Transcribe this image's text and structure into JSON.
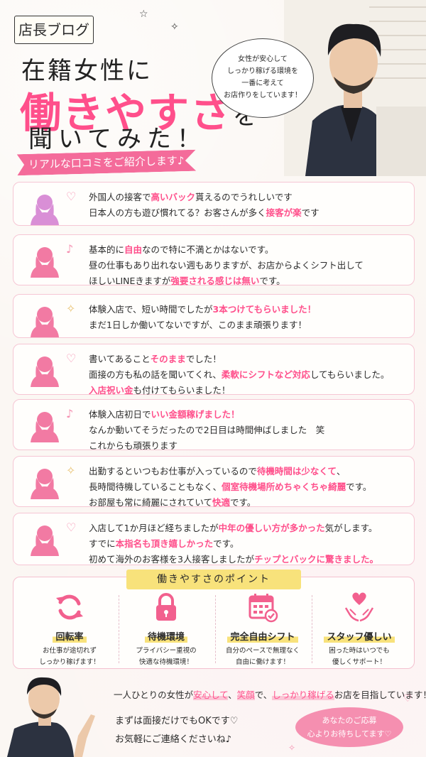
{
  "header": {
    "blog_tag": "店長ブログ",
    "title_line1": "在籍女性に",
    "title_line2_pink": "働きやすさ",
    "title_line2_rest": "を",
    "title_line3": "聞いてみた！",
    "ribbon": "リアルな口コミをご紹介します♪",
    "bubble": [
      "女性が安心して",
      "しっかり稼げる環境を",
      "一番に考えて",
      "お店作りをしています！"
    ]
  },
  "reviews": [
    {
      "avatar_color": "#d98fd6",
      "lines": [
        [
          [
            "外国人の接客で",
            false
          ],
          [
            "高いバック",
            true
          ],
          [
            "貰えるのでうれしいです",
            false
          ]
        ],
        [
          [
            "日本人の方も遊び慣れてる？お客さんが多く",
            false
          ],
          [
            "接客が楽",
            true
          ],
          [
            "です",
            false
          ]
        ]
      ]
    },
    {
      "avatar_color": "#f27aa3",
      "lines": [
        [
          [
            "基本的に",
            false
          ],
          [
            "自由",
            true
          ],
          [
            "なので特に不満とかはないです。",
            false
          ]
        ],
        [
          [
            "昼の仕事もあり出れない週もありますが、お店からよくシフト出して",
            false
          ]
        ],
        [
          [
            "ほしいLINEきますが",
            false
          ],
          [
            "強要される感じは無い",
            true
          ],
          [
            "です。",
            false
          ]
        ]
      ]
    },
    {
      "avatar_color": "#f27aa3",
      "lines": [
        [
          [
            "体験入店で、短い時間でしたが",
            false
          ],
          [
            "3本つけてもらいました！",
            true
          ]
        ],
        [
          [
            "まだ1日しか働いてないですが、このまま頑張ります！",
            false
          ]
        ]
      ]
    },
    {
      "avatar_color": "#f27aa3",
      "lines": [
        [
          [
            "書いてあること",
            false
          ],
          [
            "そのまま",
            true
          ],
          [
            "でした！",
            false
          ]
        ],
        [
          [
            "面接の方も私の話を聞いてくれ、",
            false
          ],
          [
            "柔軟にシフトなど対応",
            true
          ],
          [
            "してもらいました。",
            false
          ]
        ],
        [
          [
            "入店祝い金",
            true
          ],
          [
            "も付けてもらいました！",
            false
          ]
        ]
      ]
    },
    {
      "avatar_color": "#f27aa3",
      "lines": [
        [
          [
            "体験入店初日で",
            false
          ],
          [
            "いい金額稼げました！",
            true
          ]
        ],
        [
          [
            "なんか動いてそうだったので2日目は時間伸ばしました　笑",
            false
          ]
        ],
        [
          [
            "これからも頑張ります",
            false
          ]
        ]
      ]
    },
    {
      "avatar_color": "#f27aa3",
      "lines": [
        [
          [
            "出勤するといつもお仕事が入っているので",
            false
          ],
          [
            "待機時間は少なくて",
            true
          ],
          [
            "、",
            false
          ]
        ],
        [
          [
            "長時間待機していることもなく、",
            false
          ],
          [
            "個室待機場所めちゃくちゃ綺麗",
            true
          ],
          [
            "です。",
            false
          ]
        ],
        [
          [
            "お部屋も常に綺麗にされていて",
            false
          ],
          [
            "快適",
            true
          ],
          [
            "です。",
            false
          ]
        ]
      ]
    },
    {
      "avatar_color": "#f27aa3",
      "lines": [
        [
          [
            "入店して1か月ほど経ちましたが",
            false
          ],
          [
            "中年の優しい方が多かった",
            true
          ],
          [
            "気がします。",
            false
          ]
        ],
        [
          [
            "すでに",
            false
          ],
          [
            "本指名も頂き嬉しかった",
            true
          ],
          [
            "です。",
            false
          ]
        ],
        [
          [
            "初めて海外のお客様を3人接客しましたが",
            false
          ],
          [
            "チップとバックに驚きました。",
            true
          ]
        ]
      ]
    }
  ],
  "points": {
    "label": "働きやすさのポイント",
    "items": [
      {
        "title": "回転率",
        "desc": [
          "お仕事が途切れず",
          "しっかり稼げます！"
        ],
        "icon": "refresh-icon"
      },
      {
        "title": "待機環境",
        "desc": [
          "プライバシー重視の",
          "快適な待機環境！"
        ],
        "icon": "lock-icon"
      },
      {
        "title": "完全自由シフト",
        "desc": [
          "自分のペースで無理なく",
          "自由に働けます！"
        ],
        "icon": "calendar-icon"
      },
      {
        "title": "スタッフ優しい",
        "desc": [
          "困った時はいつでも",
          "優しくサポート！"
        ],
        "icon": "hands-heart-icon"
      }
    ]
  },
  "footer": {
    "line1_parts": [
      [
        "一人ひとりの女性が",
        false
      ],
      [
        "安心して",
        true
      ],
      [
        "、",
        false
      ],
      [
        "笑顔",
        true
      ],
      [
        "で、",
        false
      ],
      [
        "しっかり稼げる",
        true
      ],
      [
        "お店を目指しています！",
        false
      ]
    ],
    "line2": "まずは面接だけでもOKです♡",
    "line3": "お気軽にご連絡くださいね♪",
    "cta_line1": "あなたのご応募",
    "cta_line2": "心よりお待ちしてます♡"
  },
  "colors": {
    "accent": "#ff4f8b",
    "ribbon": "#f46b9a",
    "highlight": "#f8e27b",
    "card_border": "#f6c6d4"
  }
}
